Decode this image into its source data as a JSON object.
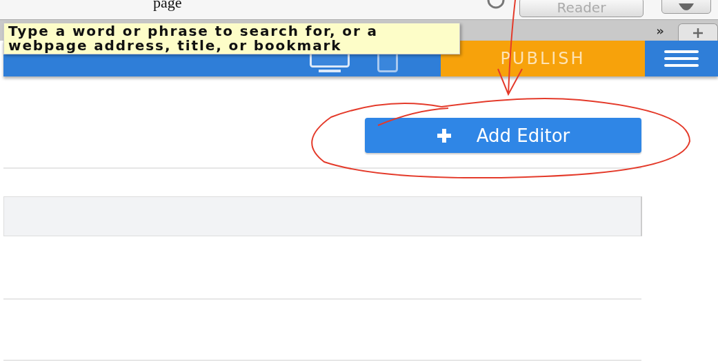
{
  "browser": {
    "page_title_fragment": "page",
    "reader_button": "Reader",
    "tab_overflow": "»"
  },
  "tooltip": {
    "text": "Type a word or phrase to search for, or a webpage address, title, or bookmark"
  },
  "app_bar": {
    "publish_button": "PUBLISH"
  },
  "content": {
    "add_button": "Add Editor"
  }
}
